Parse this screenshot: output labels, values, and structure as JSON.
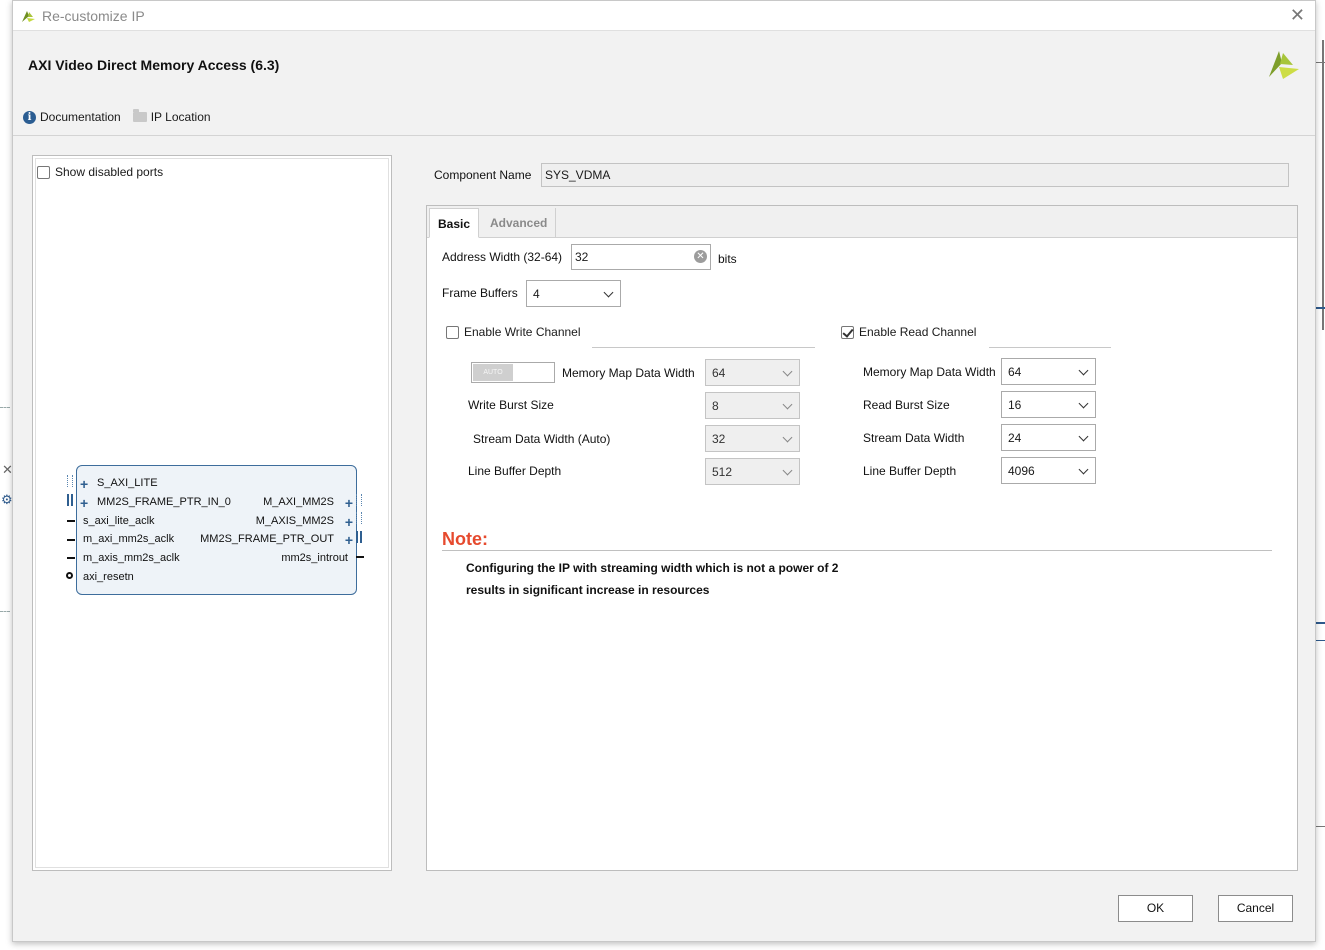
{
  "window": {
    "title": "Re-customize IP"
  },
  "header": {
    "ip_name": "AXI Video Direct Memory Access (6.3)"
  },
  "links": {
    "documentation": "Documentation",
    "ip_location": "IP Location"
  },
  "preview": {
    "show_disabled_ports": {
      "label": "Show disabled ports",
      "checked": false
    },
    "ports_left": [
      "S_AXI_LITE",
      "MM2S_FRAME_PTR_IN_0",
      "s_axi_lite_aclk",
      "m_axi_mm2s_aclk",
      "m_axis_mm2s_aclk",
      "axi_resetn"
    ],
    "ports_right": [
      "M_AXI_MM2S",
      "M_AXIS_MM2S",
      "MM2S_FRAME_PTR_OUT",
      "mm2s_introut"
    ]
  },
  "component": {
    "label": "Component Name",
    "value": "SYS_VDMA"
  },
  "tabs": {
    "basic": "Basic",
    "advanced": "Advanced"
  },
  "basic": {
    "address_width": {
      "label": "Address Width (32-64)",
      "value": "32",
      "unit": "bits"
    },
    "frame_buffers": {
      "label": "Frame Buffers",
      "value": "4"
    },
    "write": {
      "label": "Enable Write Channel",
      "checked": false,
      "auto_label": "AUTO",
      "mm_data_width": {
        "label": "Memory Map Data Width",
        "value": "64"
      },
      "burst_size": {
        "label": "Write Burst Size",
        "value": "8"
      },
      "stream_width": {
        "label": "Stream Data Width (Auto)",
        "value": "32"
      },
      "line_buffer": {
        "label": "Line Buffer Depth",
        "value": "512"
      }
    },
    "read": {
      "label": "Enable Read Channel",
      "checked": true,
      "mm_data_width": {
        "label": "Memory Map Data Width",
        "value": "64"
      },
      "burst_size": {
        "label": "Read Burst Size",
        "value": "16"
      },
      "stream_width": {
        "label": "Stream Data Width",
        "value": "24"
      },
      "line_buffer": {
        "label": "Line Buffer Depth",
        "value": "4096"
      }
    }
  },
  "note": {
    "title": "Note:",
    "line1": "Configuring the IP with streaming width which is not a power of 2",
    "line2": "results in significant increase in resources"
  },
  "buttons": {
    "ok": "OK",
    "cancel": "Cancel"
  },
  "colors": {
    "note": "#e64a2e",
    "brand": "#8fb22f",
    "block_border": "#3d6d9c"
  }
}
